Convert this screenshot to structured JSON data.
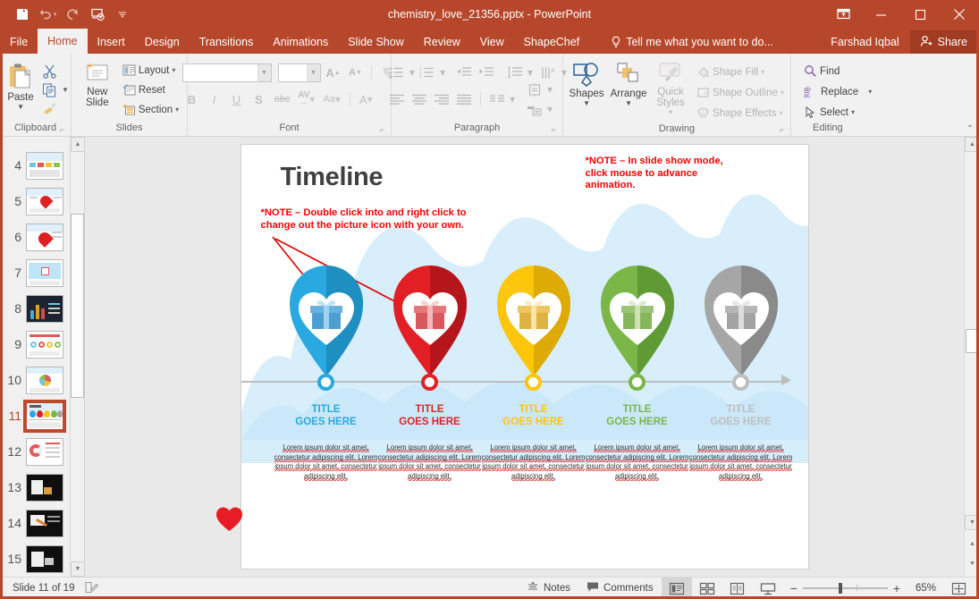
{
  "window": {
    "title": "chemistry_love_21356.pptx - PowerPoint",
    "accent_color": "#b7472a",
    "quick_access": [
      {
        "name": "save-icon",
        "label": "Save"
      },
      {
        "name": "undo-icon",
        "label": "Undo"
      },
      {
        "name": "redo-icon",
        "label": "Repeat"
      },
      {
        "name": "start-from-beginning-icon",
        "label": "Start From Beginning"
      },
      {
        "name": "customize-quick-access-toolbar-icon",
        "label": "Customize Quick Access Toolbar"
      }
    ],
    "controls": [
      {
        "name": "ribbon-display-options",
        "label": "Ribbon Display Options"
      },
      {
        "name": "minimize",
        "label": "Minimize"
      },
      {
        "name": "restore",
        "label": "Restore Down"
      },
      {
        "name": "close",
        "label": "Close"
      }
    ]
  },
  "tabs": [
    {
      "id": "file",
      "label": "File",
      "active": false
    },
    {
      "id": "home",
      "label": "Home",
      "active": true
    },
    {
      "id": "insert",
      "label": "Insert",
      "active": false
    },
    {
      "id": "design",
      "label": "Design",
      "active": false
    },
    {
      "id": "transitions",
      "label": "Transitions",
      "active": false
    },
    {
      "id": "animations",
      "label": "Animations",
      "active": false
    },
    {
      "id": "slideshow",
      "label": "Slide Show",
      "active": false
    },
    {
      "id": "review",
      "label": "Review",
      "active": false
    },
    {
      "id": "view",
      "label": "View",
      "active": false
    },
    {
      "id": "shapechef",
      "label": "ShapeChef",
      "active": false
    }
  ],
  "tellme": {
    "label": "Tell me what you want to do...",
    "icon": "lightbulb-icon"
  },
  "account": {
    "name": "Farshad Iqbal"
  },
  "share": {
    "label": "Share",
    "icon": "share-person-icon"
  },
  "ribbon": {
    "clipboard": {
      "group_label": "Clipboard",
      "paste_label": "Paste",
      "cut_label": "Cut",
      "copy_label": "Copy",
      "format_painter_label": "Format Painter"
    },
    "slides": {
      "group_label": "Slides",
      "new_slide_label": "New\nSlide",
      "layout_label": "Layout",
      "reset_label": "Reset",
      "section_label": "Section"
    },
    "font": {
      "group_label": "Font",
      "font_name_value": "",
      "font_size_value": "",
      "font_name_placeholder": "",
      "font_size_placeholder": "",
      "increase_font_label": "A",
      "decrease_font_label": "A",
      "clear_formatting_label": "Clear All Formatting",
      "bold_label": "B",
      "italic_label": "I",
      "underline_label": "U",
      "shadow_label": "S",
      "strikethrough_label": "abc",
      "character_spacing_label": "AV",
      "change_case_label": "Aa",
      "font_color_label": "A"
    },
    "paragraph": {
      "group_label": "Paragraph",
      "bullets_label": "Bullets",
      "numbering_label": "Numbering",
      "decrease_indent_label": "Decrease List Level",
      "increase_indent_label": "Increase List Level",
      "line_spacing_label": "Line Spacing",
      "text_direction_label": "Text Direction",
      "align_text_label": "Align Text",
      "convert_smartart_label": "Convert to SmartArt",
      "align_left_label": "Align Left",
      "center_label": "Center",
      "align_right_label": "Align Right",
      "justify_label": "Justify",
      "columns_label": "Columns"
    },
    "drawing": {
      "group_label": "Drawing",
      "shapes_label": "Shapes",
      "arrange_label": "Arrange",
      "quick_styles_label": "Quick\nStyles",
      "shape_fill_label": "Shape Fill",
      "shape_outline_label": "Shape Outline",
      "shape_effects_label": "Shape Effects"
    },
    "editing": {
      "group_label": "Editing",
      "find_label": "Find",
      "replace_label": "Replace",
      "select_label": "Select"
    },
    "collapse_label": "Collapse the Ribbon"
  },
  "thumbnails": {
    "selected": 11,
    "items": [
      {
        "num": "4",
        "kind": "light-chart"
      },
      {
        "num": "5",
        "kind": "heart-white"
      },
      {
        "num": "6",
        "kind": "heart-white"
      },
      {
        "num": "7",
        "kind": "map-light"
      },
      {
        "num": "8",
        "kind": "dark-chart"
      },
      {
        "num": "9",
        "kind": "light-circles"
      },
      {
        "num": "10",
        "kind": "pie-light"
      },
      {
        "num": "11",
        "kind": "timeline-pins"
      },
      {
        "num": "12",
        "kind": "donut-light"
      },
      {
        "num": "13",
        "kind": "dark-slide"
      },
      {
        "num": "14",
        "kind": "dark-slide"
      },
      {
        "num": "15",
        "kind": "dark-slide"
      }
    ]
  },
  "slide": {
    "title": "Timeline",
    "note_left": "*NOTE – Double click into and right click to\nchange out the picture icon with your own.",
    "note_right": "*NOTE – In slide show mode,\nclick mouse to advance\nanimation.",
    "body_text": "Lorem ipsum dolor sit amet, consectetur adipiscing elit. Lorem ipsum dolor sit amet, consectetur adipiscing elit.",
    "title_text": "TITLE\nGOES HERE",
    "heart_color": "#e81c24",
    "background_wave_color": "#cdeafa",
    "axis_color": "#bdbdbd",
    "items": [
      {
        "color": "#29a9e0",
        "dark": "#1f8ec0",
        "title": "TITLE\nGOES HERE",
        "icon": "gift-icon"
      },
      {
        "color": "#e31f26",
        "dark": "#b5161c",
        "title": "TITLE\nGOES HERE",
        "icon": "gift-icon"
      },
      {
        "color": "#fdc60b",
        "dark": "#ddaa06",
        "title": "TITLE\nGOES HERE",
        "icon": "gift-icon"
      },
      {
        "color": "#7ab648",
        "dark": "#5f9a34",
        "title": "TITLE\nGOES HERE",
        "icon": "gift-icon"
      },
      {
        "color": "#a6a6a6",
        "dark": "#8a8a8a",
        "title": "TITLE\nGOES HERE",
        "icon": "gift-icon"
      }
    ]
  },
  "status": {
    "slide_indicator": "Slide 11 of 19",
    "notes_label": "Notes",
    "comments_label": "Comments",
    "zoom_percent": "65%",
    "views": [
      {
        "name": "normal-view",
        "active": true
      },
      {
        "name": "slide-sorter-view",
        "active": false
      },
      {
        "name": "reading-view",
        "active": false
      },
      {
        "name": "slide-show-view",
        "active": false
      }
    ],
    "zoom_out_label": "−",
    "zoom_in_label": "+",
    "fit_slide_label": "Fit slide to current window"
  }
}
